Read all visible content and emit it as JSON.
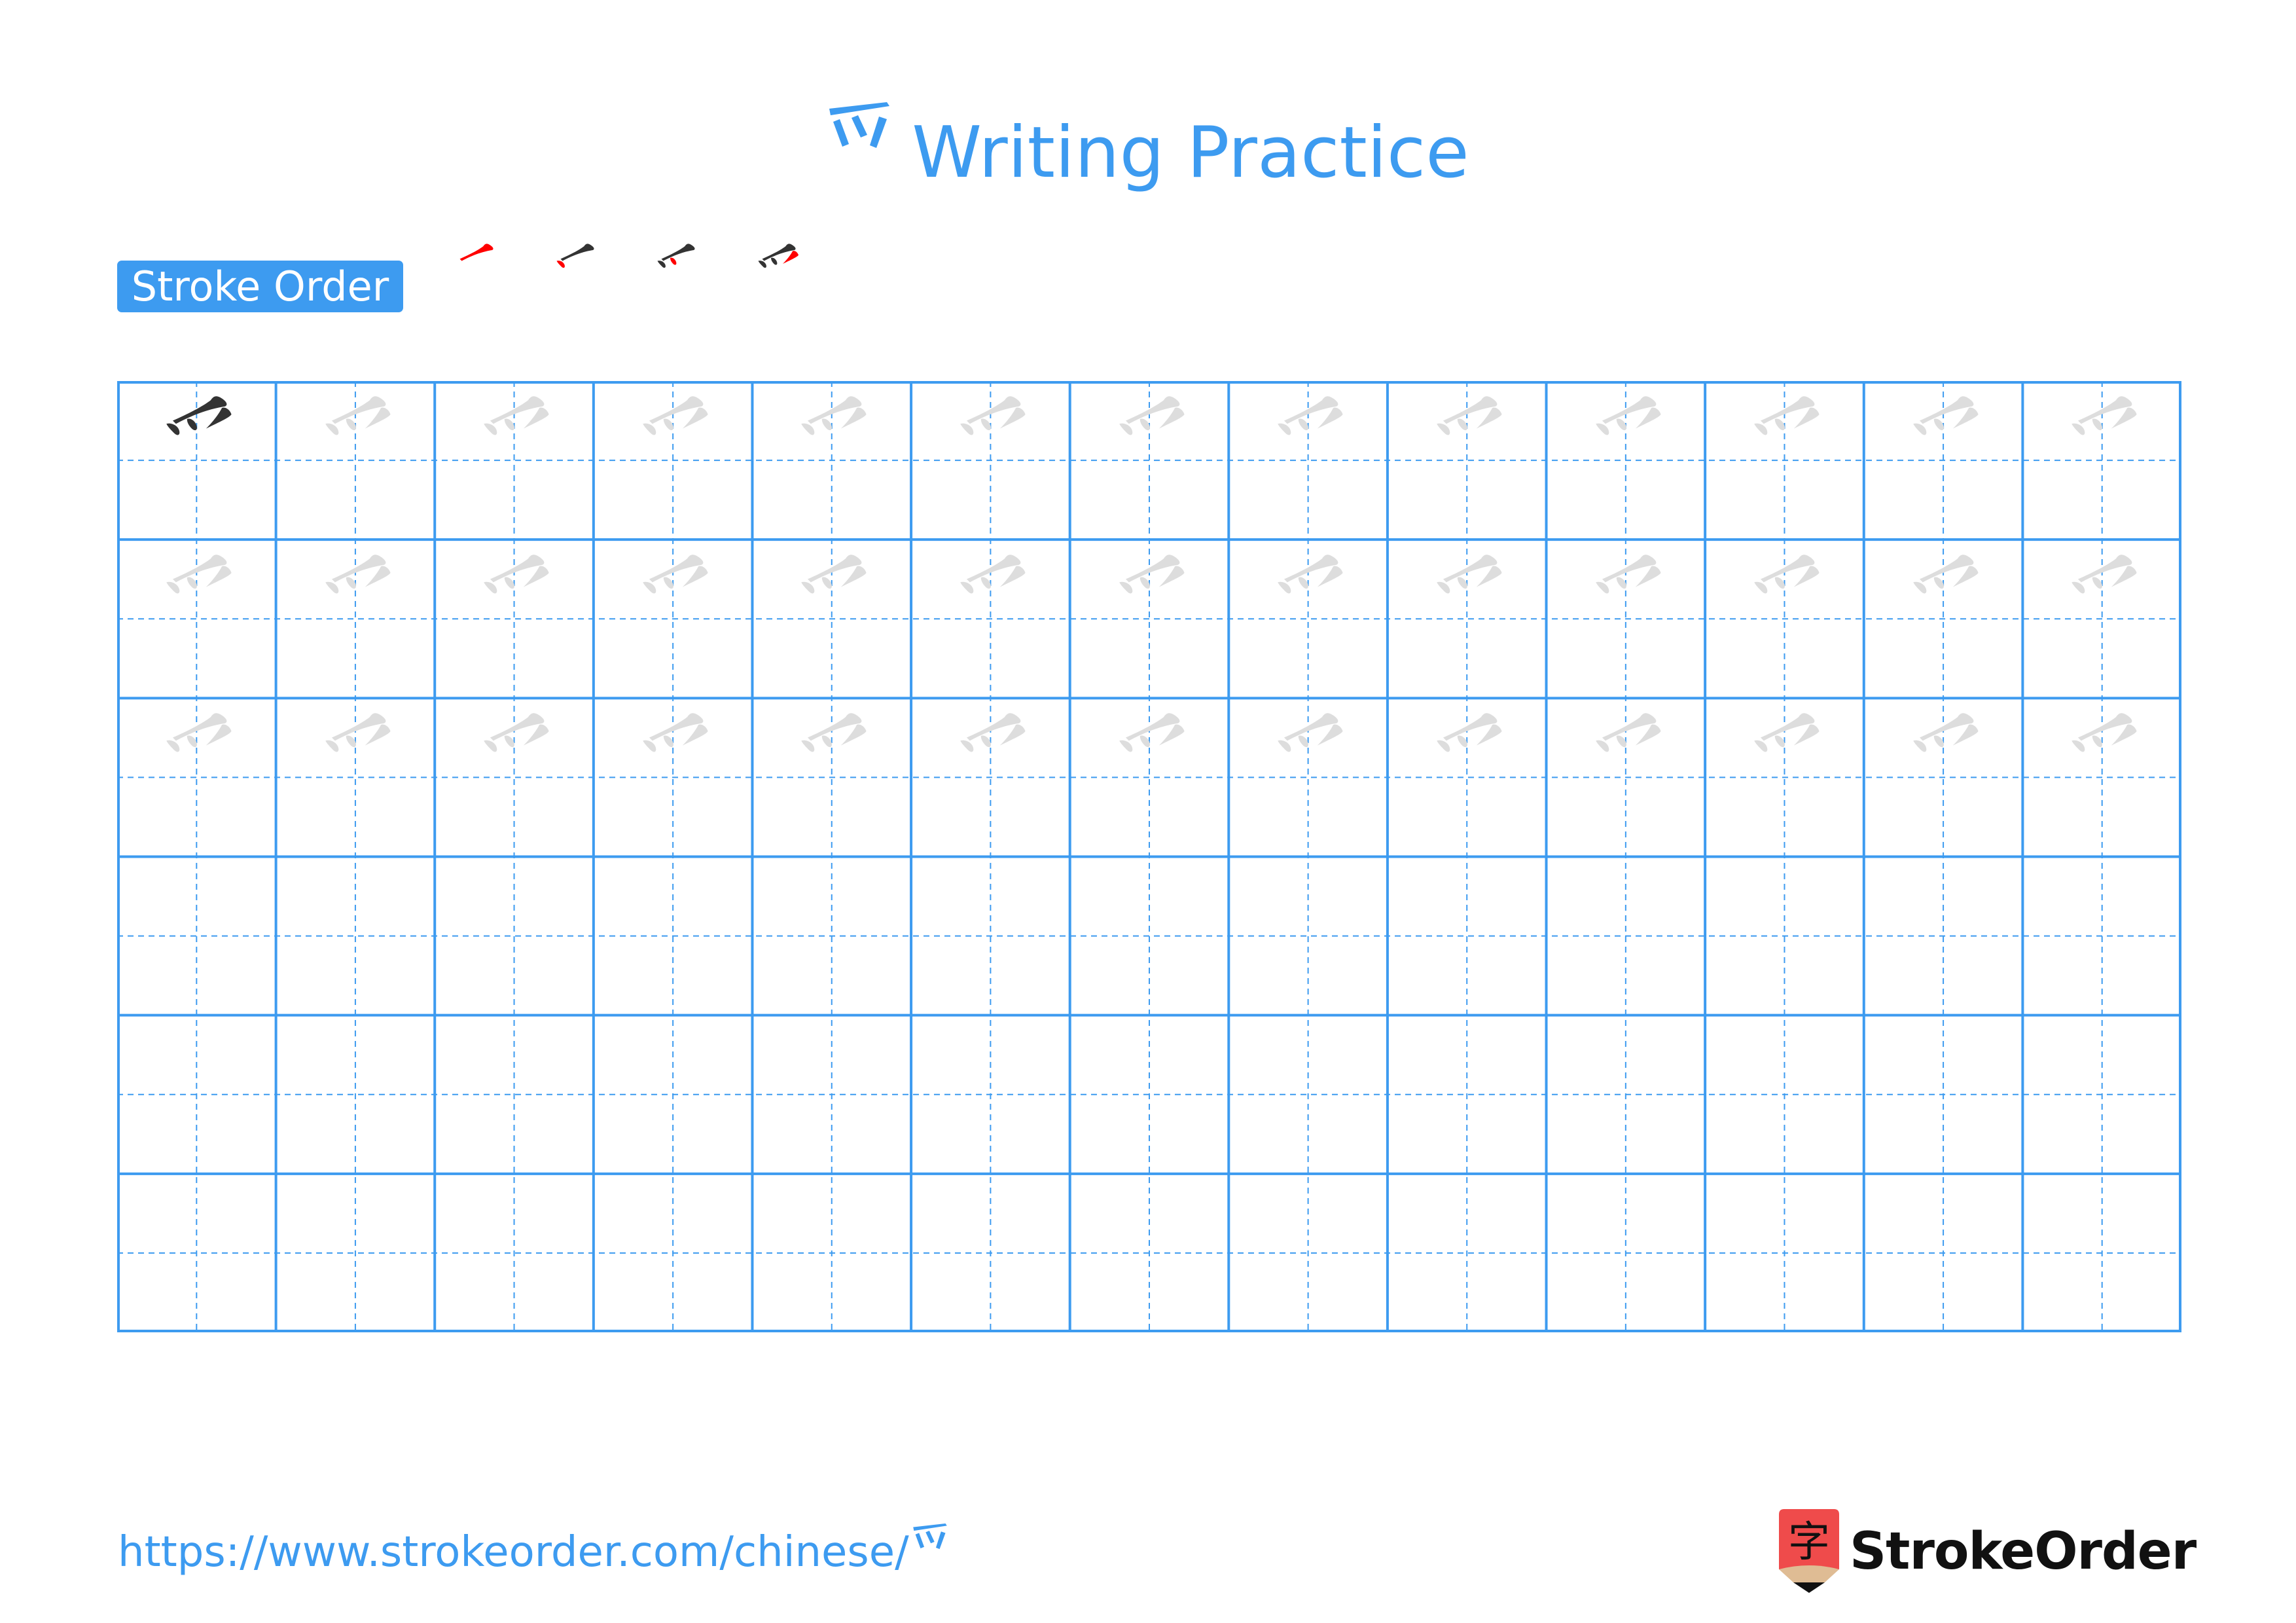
{
  "page": {
    "character": "⺤",
    "title_suffix": "Writing Practice",
    "accent_color": "#3d9bf0",
    "grid_line_color": "#3d9bf0",
    "ink_color": "#333333",
    "trace_color": "#dddddd",
    "highlight_stroke_color": "#ff0000"
  },
  "stroke_order": {
    "label": "Stroke Order",
    "total_strokes": 4,
    "steps": [
      {
        "step": 1,
        "highlighted_stroke": 1
      },
      {
        "step": 2,
        "highlighted_stroke": 2
      },
      {
        "step": 3,
        "highlighted_stroke": 3
      },
      {
        "step": 4,
        "highlighted_stroke": 4
      }
    ]
  },
  "practice_grid": {
    "columns": 13,
    "rows": 6,
    "rows_content": [
      {
        "row": 1,
        "first_cell": "model",
        "other_cells": "trace"
      },
      {
        "row": 2,
        "cells": "trace"
      },
      {
        "row": 3,
        "cells": "trace"
      },
      {
        "row": 4,
        "cells": "empty"
      },
      {
        "row": 5,
        "cells": "empty"
      },
      {
        "row": 6,
        "cells": "empty"
      }
    ]
  },
  "footer": {
    "url_text": "https://www.strokeorder.com/chinese/",
    "url_character": "⺤",
    "logo_glyph": "字",
    "logo_text": "StrokeOrder",
    "logo_red": "#ef4b4b",
    "logo_tan": "#dfbc94"
  }
}
